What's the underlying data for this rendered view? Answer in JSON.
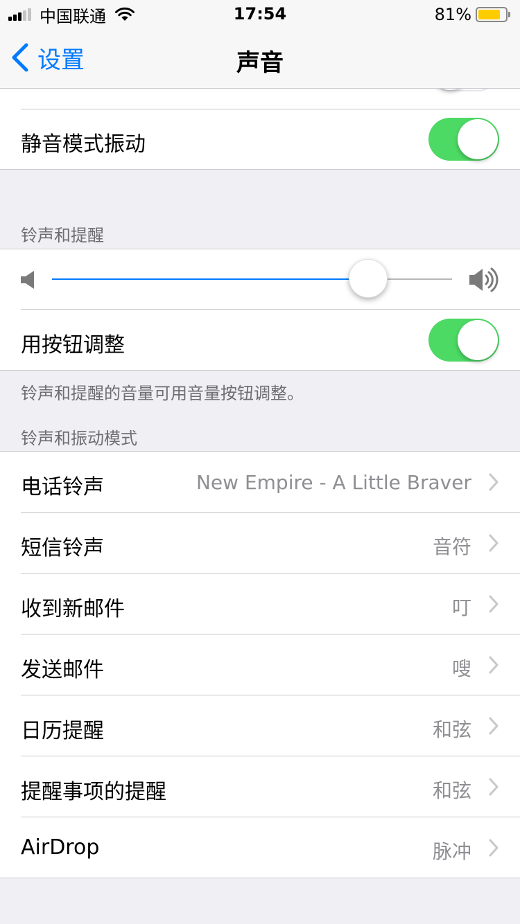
{
  "status_bar": {
    "carrier": "中国联通",
    "time": "17:54",
    "battery_percent": "81%",
    "battery_level": 0.81,
    "battery_color": "#ffcc00"
  },
  "nav": {
    "back_label": "设置",
    "title": "声音"
  },
  "vibrate_on_silent": {
    "label": "静音模式振动",
    "on": true
  },
  "ringer_section": {
    "header": "铃声和提醒",
    "volume_level": 0.79,
    "change_with_buttons": {
      "label": "用按钮调整",
      "on": true
    },
    "footer": "铃声和提醒的音量可用音量按钮调整。"
  },
  "patterns_section": {
    "header": "铃声和振动模式",
    "items": [
      {
        "label": "电话铃声",
        "value": "New Empire - A Little Braver"
      },
      {
        "label": "短信铃声",
        "value": "音符"
      },
      {
        "label": "收到新邮件",
        "value": "叮"
      },
      {
        "label": "发送邮件",
        "value": "嗖"
      },
      {
        "label": "日历提醒",
        "value": "和弦"
      },
      {
        "label": "提醒事项的提醒",
        "value": "和弦"
      },
      {
        "label": "AirDrop",
        "value": "脉冲"
      }
    ]
  },
  "colors": {
    "accent": "#007aff",
    "toggle_on": "#4cd964",
    "background": "#efeff4"
  }
}
